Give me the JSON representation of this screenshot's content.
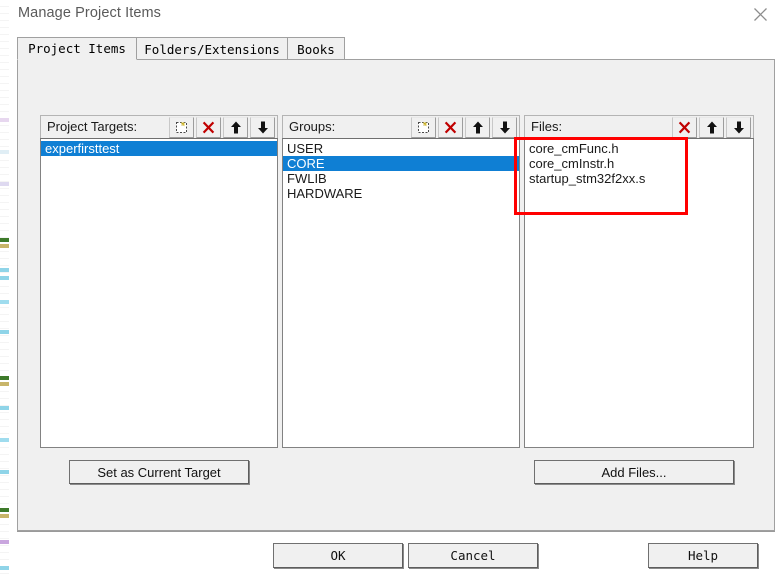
{
  "window": {
    "title": "Manage Project Items",
    "close_icon": "close-icon"
  },
  "tabs": [
    {
      "label": "Project Items",
      "active": true
    },
    {
      "label": "Folders/Extensions",
      "active": false
    },
    {
      "label": "Books",
      "active": false
    }
  ],
  "columns": {
    "project_targets": {
      "label": "Project Targets:",
      "tools": [
        "new-item-icon",
        "delete-icon",
        "move-up-icon",
        "move-down-icon"
      ],
      "items": [
        {
          "text": "experfirsttest",
          "selected": true
        }
      ]
    },
    "groups": {
      "label": "Groups:",
      "tools": [
        "new-item-icon",
        "delete-icon",
        "move-up-icon",
        "move-down-icon"
      ],
      "items": [
        {
          "text": "USER",
          "selected": false
        },
        {
          "text": "CORE",
          "selected": true
        },
        {
          "text": "FWLIB",
          "selected": false
        },
        {
          "text": "HARDWARE",
          "selected": false
        }
      ]
    },
    "files": {
      "label": "Files:",
      "tools": [
        "delete-icon",
        "move-up-icon",
        "move-down-icon"
      ],
      "items": [
        {
          "text": "core_cmFunc.h",
          "selected": false
        },
        {
          "text": "core_cmInstr.h",
          "selected": false
        },
        {
          "text": "startup_stm32f2xx.s",
          "selected": false
        }
      ]
    }
  },
  "actions": {
    "set_as_current_target": "Set as Current Target",
    "add_files": "Add Files..."
  },
  "footer": {
    "ok": "OK",
    "cancel": "Cancel",
    "help": "Help"
  },
  "annotation": {
    "color": "#ff0000",
    "target": "files-list"
  },
  "colors": {
    "selection_blue": "#0f7fd4",
    "dialog_face": "#f0f0f0",
    "delete_red": "#c00000",
    "annotation_red": "#ff0000"
  }
}
